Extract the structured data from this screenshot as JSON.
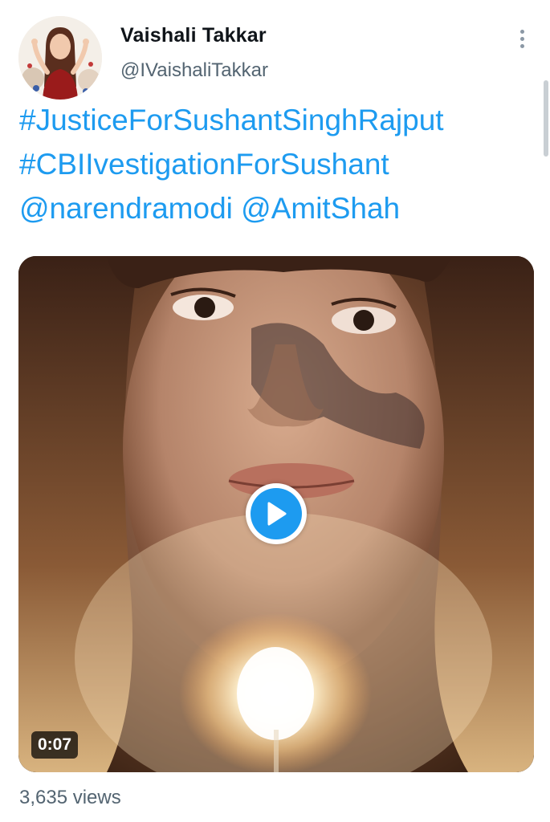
{
  "author": {
    "display_name": "Vaishali Takkar",
    "handle": "@IVaishaliTakkar",
    "avatar_icon": "profile-photo"
  },
  "tweet": {
    "text_lines": [
      "#JusticeForSushantSinghRajput",
      "#CBIIvestigationForSushant",
      "@narendramodi @AmitShah"
    ],
    "link_color": "#1d9bf0"
  },
  "media": {
    "type": "video",
    "duration": "0:07",
    "play_icon": "play-icon"
  },
  "stats": {
    "views": "3,635 views"
  },
  "menu": {
    "icon": "more-vertical-icon"
  }
}
